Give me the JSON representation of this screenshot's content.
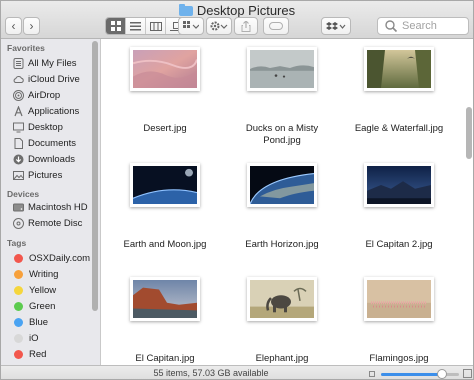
{
  "window": {
    "title": "Desktop Pictures"
  },
  "toolbar": {
    "back_glyph": "‹",
    "forward_glyph": "›",
    "search_placeholder": "Search",
    "view_modes": [
      "icon-view-icon",
      "list-view-icon",
      "column-view-icon",
      "cover-flow-icon"
    ],
    "selected_view": "icon-view-icon"
  },
  "sidebar": {
    "favorites_header": "Favorites",
    "favorites": [
      {
        "label": "All My Files",
        "icon": "all-files-icon"
      },
      {
        "label": "iCloud Drive",
        "icon": "cloud-icon"
      },
      {
        "label": "AirDrop",
        "icon": "airdrop-icon"
      },
      {
        "label": "Applications",
        "icon": "applications-icon"
      },
      {
        "label": "Desktop",
        "icon": "desktop-icon"
      },
      {
        "label": "Documents",
        "icon": "documents-icon"
      },
      {
        "label": "Downloads",
        "icon": "downloads-icon"
      },
      {
        "label": "Pictures",
        "icon": "pictures-icon"
      }
    ],
    "devices_header": "Devices",
    "devices": [
      {
        "label": "Macintosh HD",
        "icon": "hard-drive-icon"
      },
      {
        "label": "Remote Disc",
        "icon": "disc-icon"
      }
    ],
    "tags_header": "Tags",
    "tags": [
      {
        "label": "OSXDaily.com",
        "color": "#f2574d"
      },
      {
        "label": "Writing",
        "color": "#f7a03b"
      },
      {
        "label": "Yellow",
        "color": "#f5d63d"
      },
      {
        "label": "Green",
        "color": "#5ccb4f"
      },
      {
        "label": "Blue",
        "color": "#4aa3f2"
      },
      {
        "label": "iO",
        "color": "#d8d8d8"
      },
      {
        "label": "Red",
        "color": "#f2574d"
      }
    ]
  },
  "files": [
    {
      "name_lines": [
        "Desert.jpg"
      ]
    },
    {
      "name_lines": [
        "Ducks on a Misty",
        "Pond.jpg"
      ]
    },
    {
      "name_lines": [
        "Eagle & Waterfall.jpg"
      ]
    },
    {
      "name_lines": [
        "Earth and Moon.jpg"
      ]
    },
    {
      "name_lines": [
        "Earth Horizon.jpg"
      ]
    },
    {
      "name_lines": [
        "El Capitan 2.jpg"
      ]
    },
    {
      "name_lines": [
        "El Capitan.jpg"
      ]
    },
    {
      "name_lines": [
        "Elephant.jpg"
      ]
    },
    {
      "name_lines": [
        "Flamingos.jpg"
      ]
    }
  ],
  "status": {
    "text": "55 items, 57.03 GB available",
    "icon_size_fraction": 0.78
  },
  "colors": {
    "accent": "#3b8eea",
    "folder": "#6fb2ec"
  }
}
